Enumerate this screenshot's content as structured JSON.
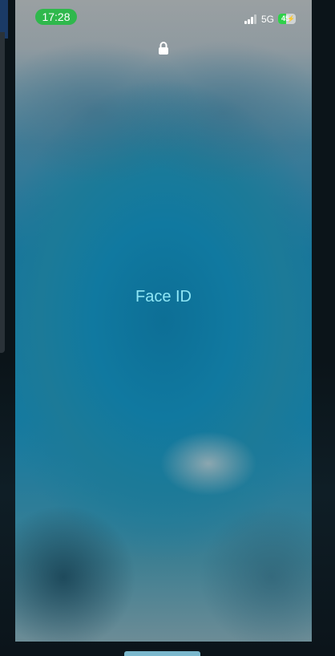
{
  "status_bar": {
    "time": "17:28",
    "network": "5G",
    "battery_level": "45",
    "battery_fraction": 0.45,
    "signal_bars_active": 3,
    "signal_bars_total": 4,
    "charging": true,
    "time_pill_color": "#2fb84c",
    "battery_color": "#2fd14a"
  },
  "lock_screen": {
    "locked": true,
    "lock_icon": "lock-icon",
    "face_id_label": "Face ID",
    "face_id_color": "#8fe6f5"
  }
}
